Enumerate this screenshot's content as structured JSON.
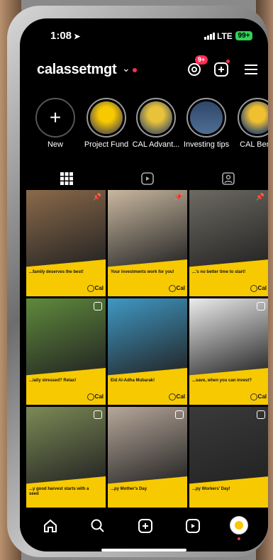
{
  "status": {
    "time": "1:08",
    "network": "LTE",
    "battery": "99+"
  },
  "header": {
    "username": "calassetmgt",
    "notification_badge": "9+"
  },
  "stories": [
    {
      "label": "New"
    },
    {
      "label": "Project Fund"
    },
    {
      "label": "CAL Advant..."
    },
    {
      "label": "Investing tips"
    },
    {
      "label": "CAL Bene"
    }
  ],
  "posts": [
    {
      "caption": "...family deserves the best!",
      "logo": "Cal",
      "badge": "pin",
      "photo": "#8b6a4a"
    },
    {
      "caption": "Your investments work for you!",
      "logo": "Cal",
      "badge": "pin",
      "photo": "#c9b8a0"
    },
    {
      "caption": "...'s no better time to start!",
      "logo": "Cal",
      "badge": "pin",
      "photo": "#6d6a62"
    },
    {
      "caption": "...ially stressed? Relax!",
      "logo": "Cal",
      "badge": "reel",
      "photo": "#5f8a3c"
    },
    {
      "caption": "Eid Al-Adha Mubarak!",
      "logo": "Cal",
      "badge": "none",
      "photo": "#3f98c4"
    },
    {
      "caption": "...save, when you can invest?",
      "logo": "Cal",
      "badge": "reel",
      "photo": "#ececec"
    },
    {
      "caption": "...y good harvest starts with a seed",
      "logo": "",
      "badge": "reel",
      "photo": "#7c8a55"
    },
    {
      "caption": "...py Mother's Day",
      "logo": "",
      "badge": "reel",
      "photo": "#b7a79a"
    },
    {
      "caption": "...py Workers' Day!",
      "logo": "",
      "badge": "reel",
      "photo": "#3a3a3a"
    }
  ],
  "colors": {
    "accent": "#f7c900",
    "badge": "#ff2d55",
    "battery": "#30d158"
  }
}
